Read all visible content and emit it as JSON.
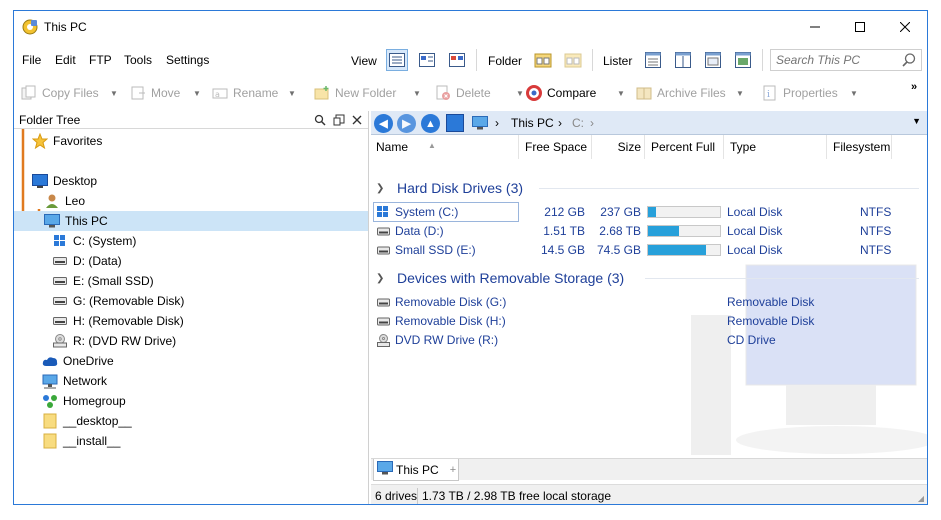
{
  "window": {
    "title": "This PC"
  },
  "menu": {
    "items": [
      "File",
      "Edit",
      "FTP",
      "Tools",
      "Settings"
    ],
    "view_label": "View",
    "folder_label": "Folder",
    "lister_label": "Lister"
  },
  "search": {
    "placeholder": "Search This PC"
  },
  "toolbar": {
    "copy_files": "Copy Files",
    "move": "Move",
    "rename": "Rename",
    "new_folder": "New Folder",
    "delete": "Delete",
    "compare": "Compare",
    "archive_files": "Archive Files",
    "properties": "Properties",
    "overflow": "»"
  },
  "folder_tree": {
    "title": "Folder Tree",
    "items": [
      {
        "label": "Favorites",
        "icon": "star-icon"
      },
      {
        "label": "Desktop",
        "icon": "desktop-icon"
      },
      {
        "label": "Leo",
        "icon": "user-icon"
      },
      {
        "label": "This PC",
        "icon": "computer-icon"
      },
      {
        "label": "C: (System)",
        "icon": "windows-drive-icon"
      },
      {
        "label": "D: (Data)",
        "icon": "drive-icon"
      },
      {
        "label": "E: (Small SSD)",
        "icon": "drive-icon"
      },
      {
        "label": "G: (Removable Disk)",
        "icon": "drive-icon"
      },
      {
        "label": "H: (Removable Disk)",
        "icon": "drive-icon"
      },
      {
        "label": "R: (DVD RW Drive)",
        "icon": "dvd-drive-icon"
      },
      {
        "label": "OneDrive",
        "icon": "cloud-icon"
      },
      {
        "label": "Network",
        "icon": "network-icon"
      },
      {
        "label": "Homegroup",
        "icon": "homegroup-icon"
      },
      {
        "label": "__desktop__",
        "icon": "folder-icon"
      },
      {
        "label": "__install__",
        "icon": "folder-icon"
      }
    ]
  },
  "address": {
    "crumb": "This PC",
    "crumb_dim": "C:",
    "separator": "›"
  },
  "columns": [
    "Name",
    "Free Space",
    "Size",
    "Percent Full",
    "Type",
    "Filesystem"
  ],
  "groups": [
    {
      "title": "Hard Disk Drives (3)",
      "rows": [
        {
          "name": "System (C:)",
          "free": "212 GB",
          "size": "237 GB",
          "percent": 0.105,
          "type": "Local Disk",
          "fs": "NTFS",
          "icon": "windows-drive-icon"
        },
        {
          "name": "Data (D:)",
          "free": "1.51 TB",
          "size": "2.68 TB",
          "percent": 0.437,
          "type": "Local Disk",
          "fs": "NTFS",
          "icon": "drive-icon"
        },
        {
          "name": "Small SSD (E:)",
          "free": "14.5 GB",
          "size": "74.5 GB",
          "percent": 0.805,
          "type": "Local Disk",
          "fs": "NTFS",
          "icon": "drive-icon"
        }
      ]
    },
    {
      "title": "Devices with Removable Storage (3)",
      "rows": [
        {
          "name": "Removable Disk (G:)",
          "type": "Removable Disk",
          "icon": "drive-icon"
        },
        {
          "name": "Removable Disk (H:)",
          "type": "Removable Disk",
          "icon": "drive-icon"
        },
        {
          "name": "DVD RW Drive (R:)",
          "type": "CD Drive",
          "icon": "dvd-drive-icon"
        }
      ]
    }
  ],
  "tab": {
    "label": "This PC"
  },
  "status": {
    "drives": "6 drives",
    "storage": "1.73 TB / 2.98 TB free local storage"
  },
  "colors": {
    "accent": "#2b79d8",
    "link": "#1e3f99",
    "bar_fill": "#27a0da",
    "selection": "#cce4f7",
    "tree_line": "#e07a20"
  }
}
